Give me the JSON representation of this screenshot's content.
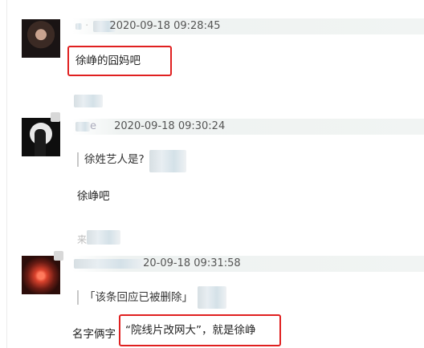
{
  "posts": [
    {
      "avatar": "user-avatar",
      "time": "2020-09-18 09:28:45",
      "time_prefix": "·",
      "body": "徐峥的囧妈吧"
    },
    {
      "avatar": "user-avatar",
      "name_tail": "e",
      "time": "2020-09-18 09:30:24",
      "quote": "徐姓艺人是?",
      "body": "徐峥吧"
    },
    {
      "avatar": "user-avatar",
      "time": "20-09-18 09:31:58",
      "quote": "「该条回应已被删除」",
      "body_prefix": "名字俩字",
      "body_highlight": "“院线片改网大”，就是徐峥"
    }
  ],
  "faint_label": "来",
  "colors": {
    "highlight": "#e02020",
    "meta_bg": "#f1f4f3"
  }
}
